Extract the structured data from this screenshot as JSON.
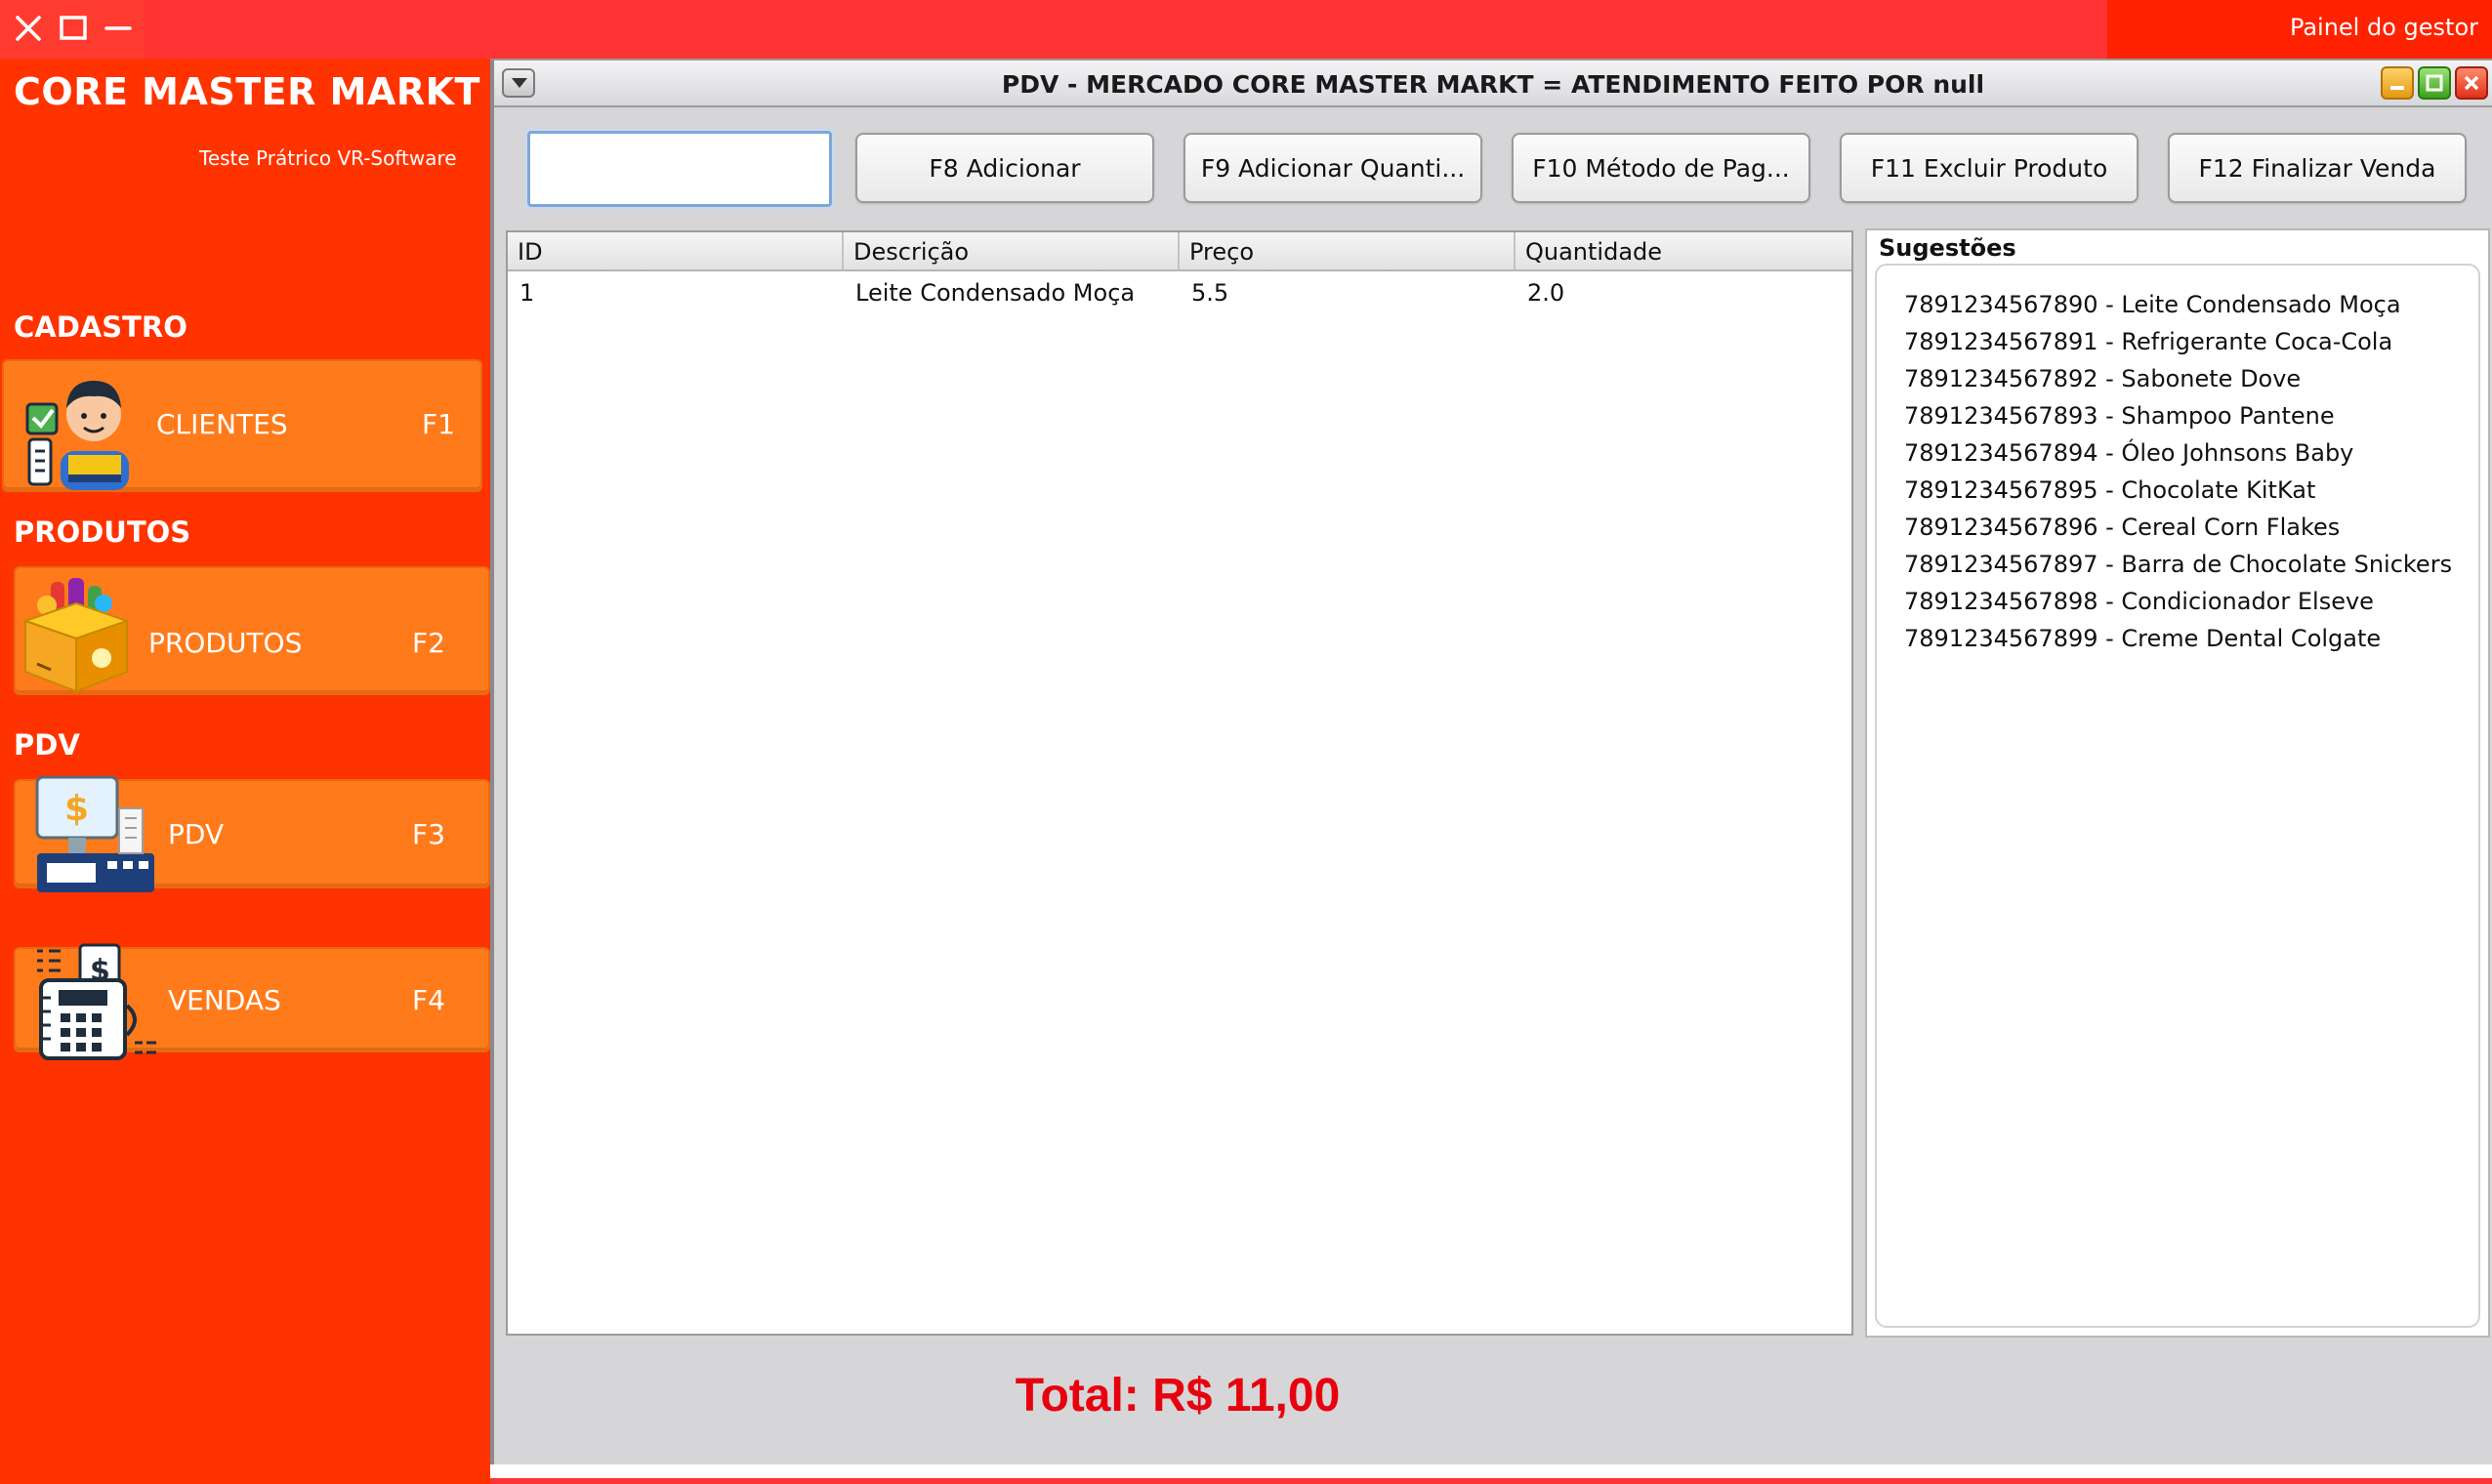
{
  "topbar": {
    "window_controls": [
      "close-icon",
      "maximize-icon",
      "minimize-icon"
    ],
    "right_label": "Painel do gestor"
  },
  "sidebar": {
    "app_title": "CORE MASTER MARKT",
    "app_subtitle": "Teste Prátrico VR-Software",
    "sections": {
      "cadastro": "CADASTRO",
      "produtos": "PRODUTOS",
      "pdv": "PDV"
    },
    "buttons": {
      "clientes": {
        "label": "CLIENTES",
        "key": "F1",
        "icon": "customer-icon"
      },
      "produtos": {
        "label": "PRODUTOS",
        "key": "F2",
        "icon": "product-box-icon"
      },
      "pdv": {
        "label": "PDV",
        "key": "F3",
        "icon": "cash-register-icon"
      },
      "vendas": {
        "label": "VENDAS",
        "key": "F4",
        "icon": "sales-terminal-icon"
      }
    }
  },
  "frame": {
    "title": "PDV - MERCADO CORE MASTER MARKT = ATENDIMENTO FEITO POR null",
    "search_value": "",
    "actions": {
      "f8": "F8 Adicionar",
      "f9": "F9 Adicionar Quanti...",
      "f10": "F10 Método de Pag...",
      "f11": "F11 Excluir Produto",
      "f12": "F12 Finalizar Venda"
    },
    "table": {
      "headers": [
        "ID",
        "Descrição",
        "Preço",
        "Quantidade"
      ],
      "rows": [
        [
          "1",
          "Leite Condensado Moça",
          "5.5",
          "2.0"
        ]
      ]
    },
    "suggestions": {
      "title": "Sugestões",
      "items": [
        "7891234567890 - Leite Condensado Moça",
        "7891234567891 - Refrigerante Coca-Cola",
        "7891234567892 - Sabonete Dove",
        "7891234567893 - Shampoo Pantene",
        "7891234567894 - Óleo Johnsons Baby",
        "7891234567895 - Chocolate KitKat",
        "7891234567896 - Cereal Corn Flakes",
        "7891234567897 - Barra de Chocolate Snickers",
        "7891234567898 - Condicionador Elseve",
        "7891234567899 - Creme Dental Colgate"
      ]
    },
    "total": "Total: R$ 11,00"
  },
  "colors": {
    "sidebar_red": "#ff3300",
    "topbar_red": "#ff3333",
    "nav_orange": "#ff7a1a",
    "total_red": "#e8000e"
  }
}
